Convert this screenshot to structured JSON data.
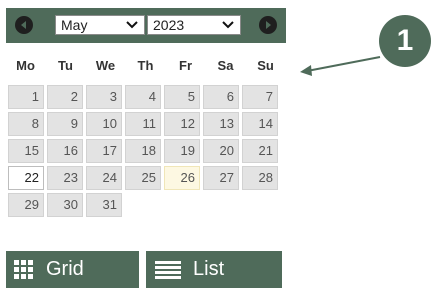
{
  "calendar": {
    "month_value": "May",
    "year_value": "2023",
    "weekdays": [
      "Mo",
      "Tu",
      "We",
      "Th",
      "Fr",
      "Sa",
      "Su"
    ],
    "days": [
      "1",
      "2",
      "3",
      "4",
      "5",
      "6",
      "7",
      "8",
      "9",
      "10",
      "11",
      "12",
      "13",
      "14",
      "15",
      "16",
      "17",
      "18",
      "19",
      "20",
      "21",
      "22",
      "23",
      "24",
      "25",
      "26",
      "27",
      "28",
      "29",
      "30",
      "31"
    ],
    "today_day": "22",
    "highlighted_day": "26",
    "prev_icon": "chevron-left-icon",
    "next_icon": "chevron-right-icon"
  },
  "view_buttons": {
    "grid_label": "Grid",
    "list_label": "List",
    "grid_icon": "grid-icon",
    "list_icon": "list-icon"
  },
  "callout": {
    "number": "1"
  },
  "colors": {
    "accent": "#4f6b5a",
    "day_background": "#e3e3e3",
    "highlight_background": "#fdf8e2"
  }
}
